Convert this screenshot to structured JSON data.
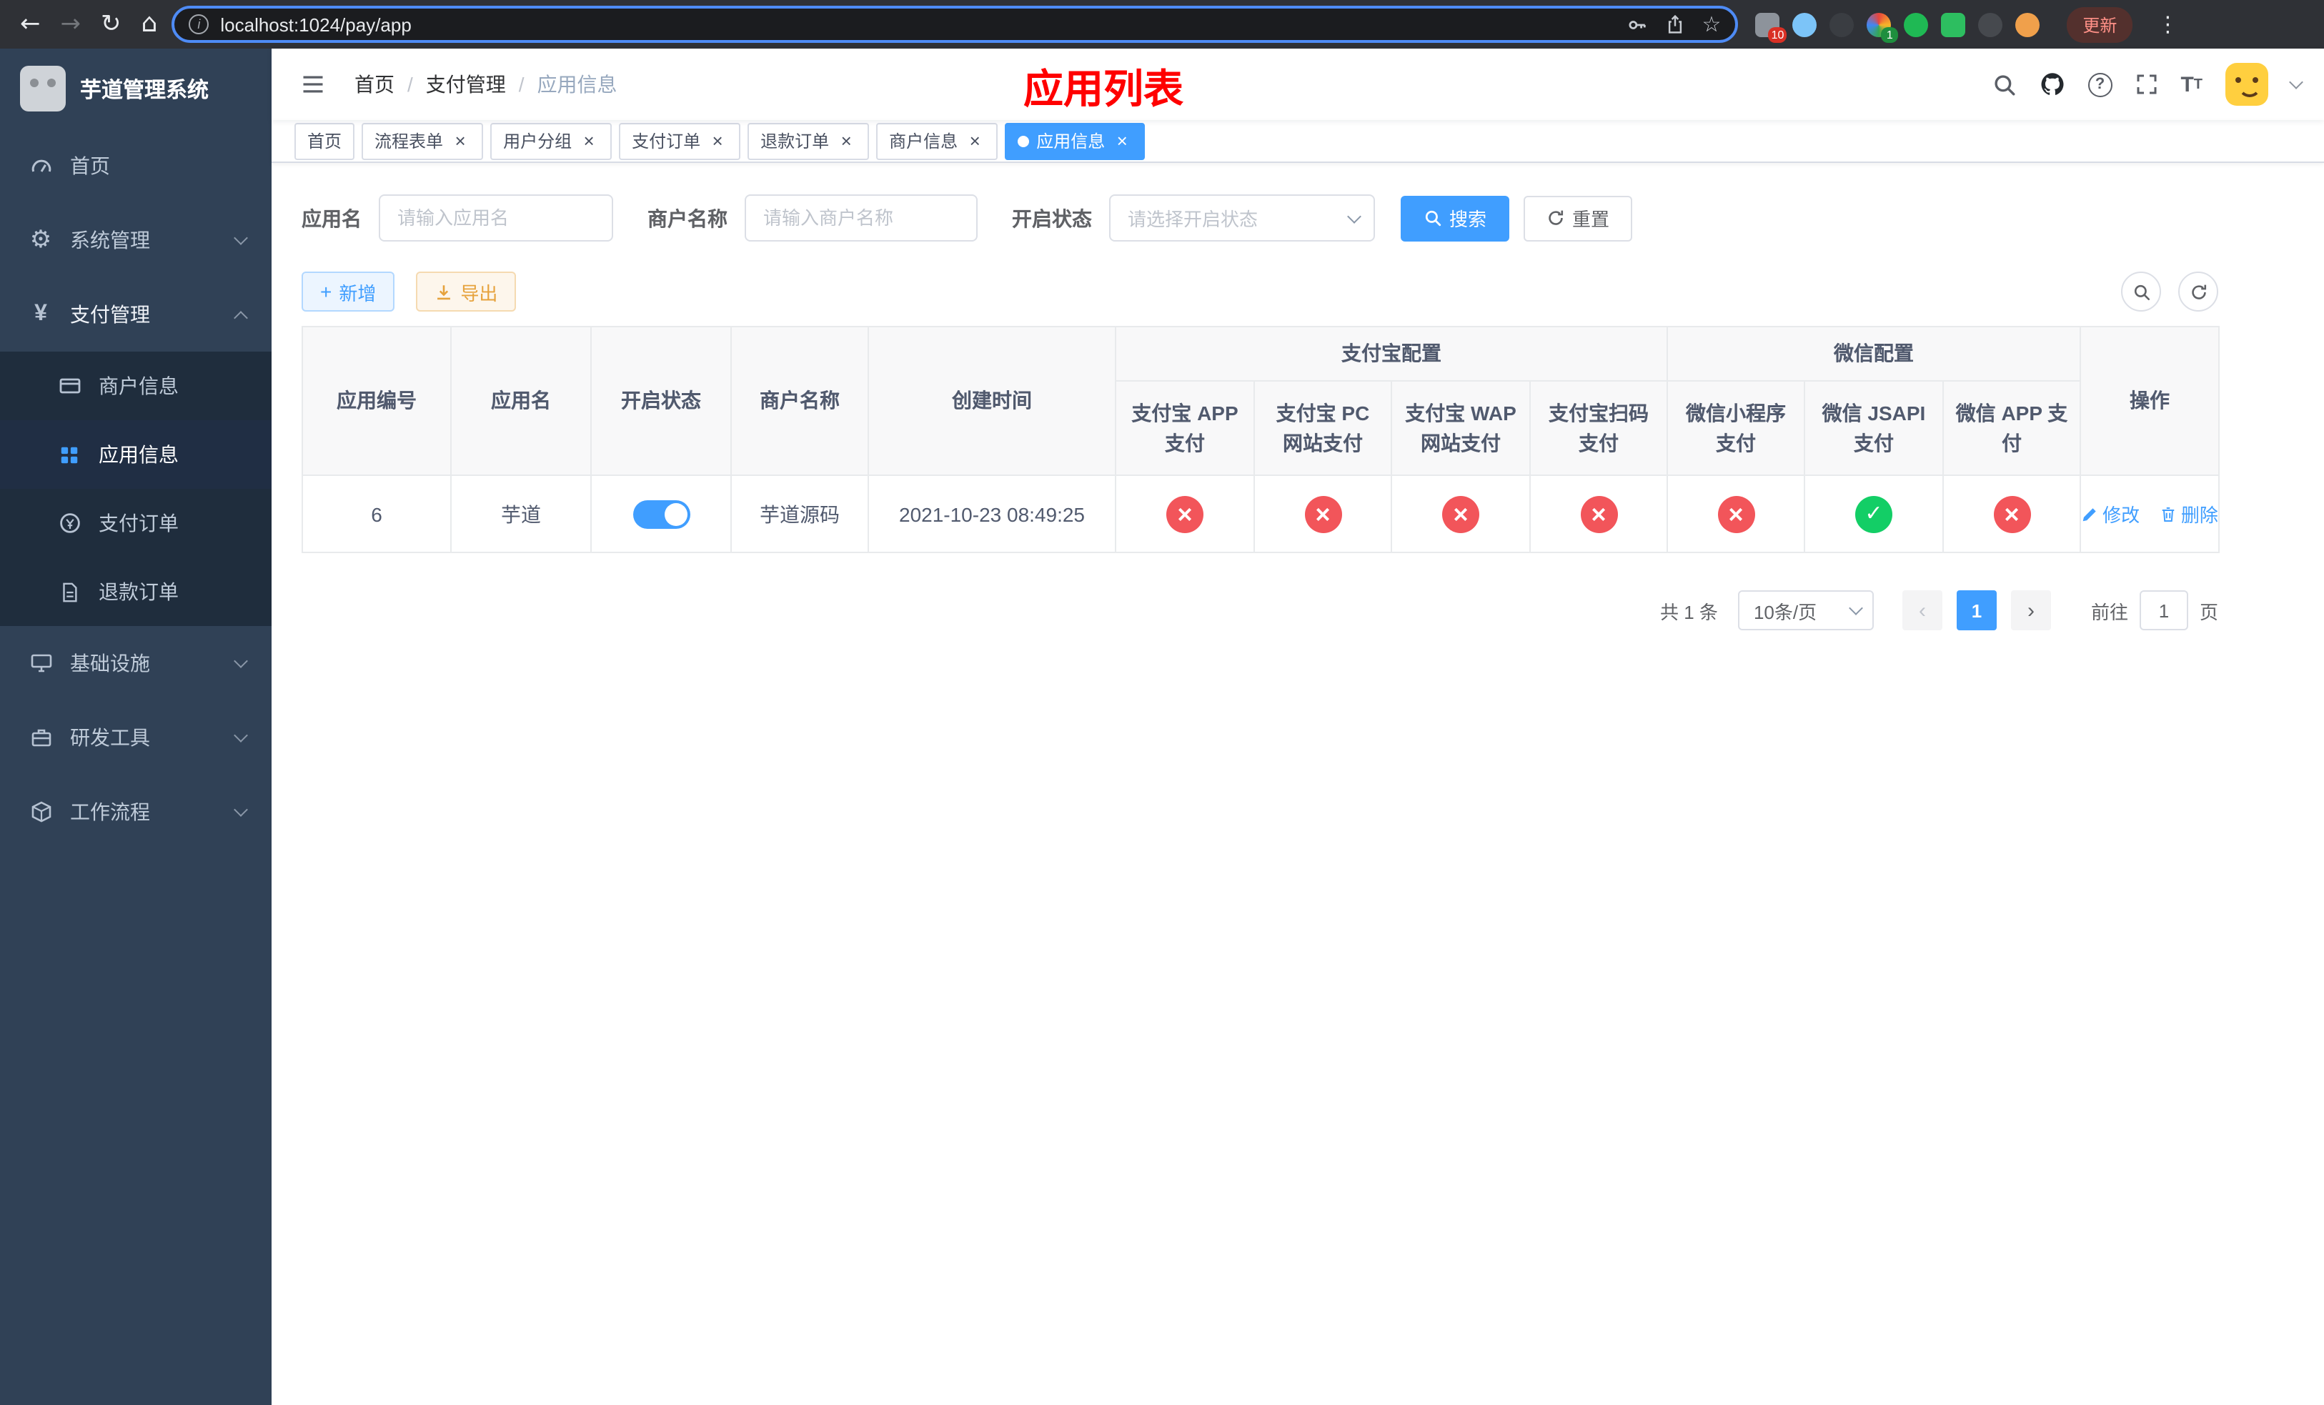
{
  "colors": {
    "accent": "#409eff",
    "danger": "#f2555a",
    "success": "#13ce66",
    "title_red": "#ff0000",
    "sidebar_bg": "#304156",
    "submenu_bg": "#1f2d3d"
  },
  "browser": {
    "url": "localhost:1024/pay/app",
    "update_label": "更新",
    "ext_badge_puzzle": "10",
    "ext_badge_colorful": "1"
  },
  "sidebar": {
    "title": "芋道管理系统",
    "menu": [
      {
        "label": "首页"
      },
      {
        "label": "系统管理",
        "expandable": true,
        "expanded": false
      },
      {
        "label": "支付管理",
        "expandable": true,
        "expanded": true
      }
    ],
    "children": [
      {
        "label": "商户信息",
        "active": false
      },
      {
        "label": "应用信息",
        "active": true
      },
      {
        "label": "支付订单",
        "active": false
      },
      {
        "label": "退款订单",
        "active": false
      }
    ],
    "menu_after": [
      {
        "label": "基础设施",
        "expandable": true,
        "expanded": false
      },
      {
        "label": "研发工具",
        "expandable": true,
        "expanded": false
      },
      {
        "label": "工作流程",
        "expandable": true,
        "expanded": false
      }
    ]
  },
  "header": {
    "breadcrumb": [
      "首页",
      "支付管理",
      "应用信息"
    ],
    "page_title": "应用列表"
  },
  "tabs": [
    {
      "label": "首页",
      "closable": false,
      "active": false
    },
    {
      "label": "流程表单",
      "closable": true,
      "active": false
    },
    {
      "label": "用户分组",
      "closable": true,
      "active": false
    },
    {
      "label": "支付订单",
      "closable": true,
      "active": false
    },
    {
      "label": "退款订单",
      "closable": true,
      "active": false
    },
    {
      "label": "商户信息",
      "closable": true,
      "active": false
    },
    {
      "label": "应用信息",
      "closable": true,
      "active": true
    }
  ],
  "filters": {
    "app_name_label": "应用名",
    "app_name_placeholder": "请输入应用名",
    "merchant_label": "商户名称",
    "merchant_placeholder": "请输入商户名称",
    "status_label": "开启状态",
    "status_placeholder": "请选择开启状态",
    "search_label": "搜索",
    "reset_label": "重置"
  },
  "toolbar": {
    "add_label": "新增",
    "export_label": "导出"
  },
  "table": {
    "headers": {
      "app_id": "应用编号",
      "app_name": "应用名",
      "status": "开启状态",
      "merchant": "商户名称",
      "created": "创建时间",
      "alipay_group": "支付宝配置",
      "alipay_cols": [
        "支付宝 APP 支付",
        "支付宝 PC 网站支付",
        "支付宝 WAP 网站支付",
        "支付宝扫码支付"
      ],
      "wechat_group": "微信配置",
      "wechat_cols": [
        "微信小程序支付",
        "微信 JSAPI 支付",
        "微信 APP 支付"
      ],
      "ops": "操作"
    },
    "row": {
      "app_id": "6",
      "app_name": "芋道",
      "enabled": true,
      "merchant": "芋道源码",
      "created": "2021-10-23 08:49:25",
      "pay_status": [
        "error",
        "error",
        "error",
        "error",
        "error",
        "success",
        "error"
      ],
      "edit_label": "修改",
      "delete_label": "删除"
    }
  },
  "pagination": {
    "total": "共 1 条",
    "page_size": "10条/页",
    "current_page": "1",
    "goto_label": "前往",
    "goto_value": "1",
    "page_suffix": "页"
  }
}
